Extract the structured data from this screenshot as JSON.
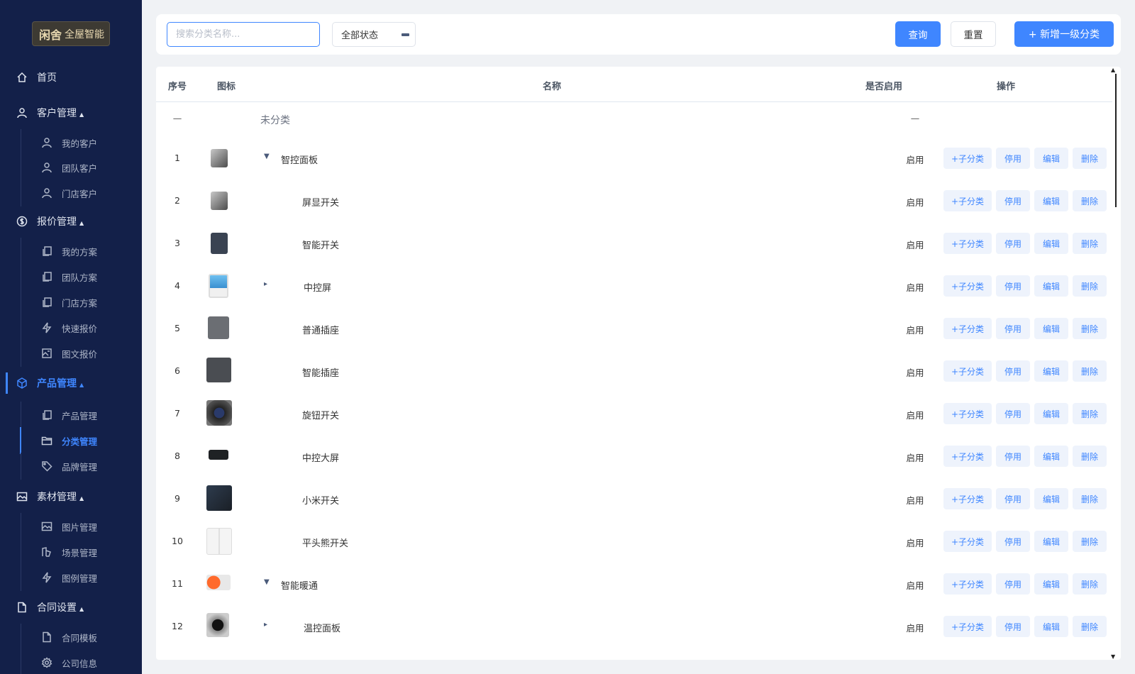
{
  "brand": {
    "seal": "闲舍",
    "name": "全屋智能"
  },
  "sidebar": {
    "home": "首页",
    "customer": {
      "label": "客户管理",
      "items": [
        "我的客户",
        "团队客户",
        "门店客户"
      ]
    },
    "quote": {
      "label": "报价管理",
      "items": [
        "我的方案",
        "团队方案",
        "门店方案",
        "快速报价",
        "图文报价"
      ]
    },
    "product": {
      "label": "产品管理",
      "items": [
        "产品管理",
        "分类管理",
        "品牌管理"
      ]
    },
    "material": {
      "label": "素材管理",
      "items": [
        "图片管理",
        "场景管理",
        "图例管理"
      ]
    },
    "contract": {
      "label": "合同设置",
      "items": [
        "合同模板",
        "公司信息"
      ]
    },
    "caret": "▲"
  },
  "filter": {
    "search_placeholder": "搜索分类名称...",
    "status": "全部状态",
    "query": "查询",
    "reset": "重置",
    "add": "+ 新增一级分类"
  },
  "table": {
    "headers": {
      "index": "序号",
      "icon": "图标",
      "name": "名称",
      "enabled": "是否启用",
      "actions": "操作"
    },
    "uncategorized": {
      "index": "—",
      "name": "未分类",
      "enabled": "—"
    },
    "ops": {
      "add_child": "+子分类",
      "disable": "停用",
      "edit": "编辑",
      "delete": "删除"
    },
    "rows": [
      {
        "index": "1",
        "name": "智控面板",
        "enabled": "启用"
      },
      {
        "index": "2",
        "name": "屏显开关",
        "enabled": "启用"
      },
      {
        "index": "3",
        "name": "智能开关",
        "enabled": "启用"
      },
      {
        "index": "4",
        "name": "中控屏",
        "enabled": "启用"
      },
      {
        "index": "5",
        "name": "普通插座",
        "enabled": "启用"
      },
      {
        "index": "6",
        "name": "智能插座",
        "enabled": "启用"
      },
      {
        "index": "7",
        "name": "旋钮开关",
        "enabled": "启用"
      },
      {
        "index": "8",
        "name": "中控大屏",
        "enabled": "启用"
      },
      {
        "index": "9",
        "name": "小米开关",
        "enabled": "启用"
      },
      {
        "index": "10",
        "name": "平头熊开关",
        "enabled": "启用"
      },
      {
        "index": "11",
        "name": "智能暖通",
        "enabled": "启用"
      },
      {
        "index": "12",
        "name": "温控面板",
        "enabled": "启用"
      }
    ],
    "toggle_open": "▼",
    "toggle_closed": "▸"
  },
  "colors": {
    "sidebar_bg": "#132049",
    "accent": "#3f86ff",
    "op_bg": "#eef3fc"
  }
}
